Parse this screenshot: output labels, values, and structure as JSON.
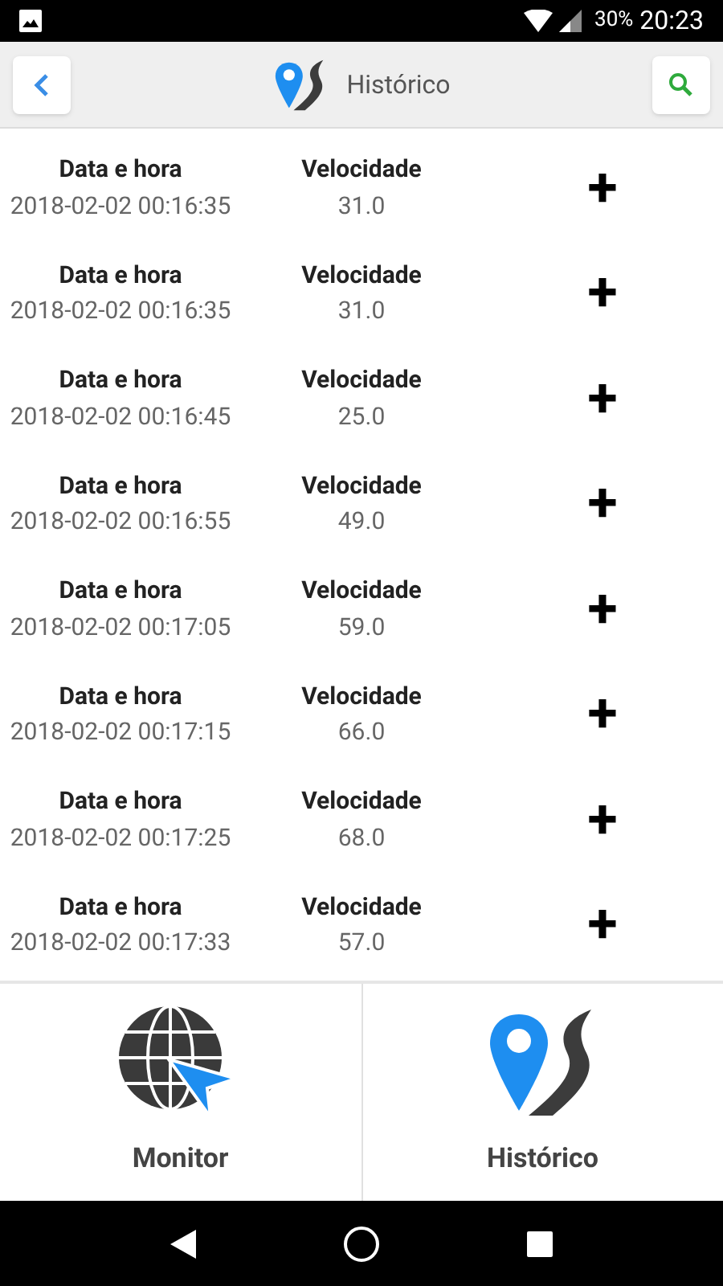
{
  "status_bar": {
    "battery": "30%",
    "time": "20:23"
  },
  "header": {
    "title": "Histórico"
  },
  "records": [
    {
      "date_label": "Data e hora",
      "date": "2018-02-02 00:16:35",
      "speed_label": "Velocidade",
      "speed": "31.0",
      "action": "+"
    },
    {
      "date_label": "Data e hora",
      "date": "2018-02-02 00:16:35",
      "speed_label": "Velocidade",
      "speed": "31.0",
      "action": "+"
    },
    {
      "date_label": "Data e hora",
      "date": "2018-02-02 00:16:45",
      "speed_label": "Velocidade",
      "speed": "25.0",
      "action": "+"
    },
    {
      "date_label": "Data e hora",
      "date": "2018-02-02 00:16:55",
      "speed_label": "Velocidade",
      "speed": "49.0",
      "action": "+"
    },
    {
      "date_label": "Data e hora",
      "date": "2018-02-02 00:17:05",
      "speed_label": "Velocidade",
      "speed": "59.0",
      "action": "+"
    },
    {
      "date_label": "Data e hora",
      "date": "2018-02-02 00:17:15",
      "speed_label": "Velocidade",
      "speed": "66.0",
      "action": "+"
    },
    {
      "date_label": "Data e hora",
      "date": "2018-02-02 00:17:25",
      "speed_label": "Velocidade",
      "speed": "68.0",
      "action": "+"
    },
    {
      "date_label": "Data e hora",
      "date": "2018-02-02 00:17:33",
      "speed_label": "Velocidade",
      "speed": "57.0",
      "action": "+"
    }
  ],
  "bottom_tabs": [
    {
      "label": "Monitor",
      "kind": "monitor"
    },
    {
      "label": "Histórico",
      "kind": "history"
    }
  ]
}
